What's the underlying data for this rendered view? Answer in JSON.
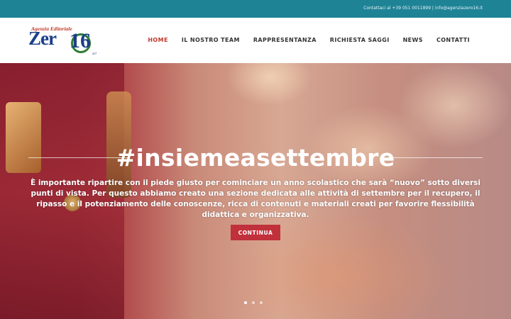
{
  "topbar": {
    "contact_text": "Contattaci al +39 051 0011899 | info@agenziazero16.it"
  },
  "logo": {
    "tagline": "Agenzia Editoriale",
    "word": "Zer",
    "number": "16",
    "suffix": "srl"
  },
  "nav": {
    "items": [
      {
        "label": "HOME"
      },
      {
        "label": "IL NOSTRO TEAM"
      },
      {
        "label": "RAPPRESENTANZA"
      },
      {
        "label": "RICHIESTA SAGGI"
      },
      {
        "label": "NEWS"
      },
      {
        "label": "CONTATTI"
      }
    ],
    "active_color": "#c0392b"
  },
  "hero": {
    "headline": "#insiemeasettembre",
    "body": "È importante ripartire con il piede giusto per cominciare un anno scolastico che sarà “nuovo” sotto diversi punti di vista. Per questo abbiamo creato una sezione dedicata alle attività di settembre per il recupero, il ripasso e il potenziamento delle conoscenze, ricca di contenuti e materiali creati per favorire flessibilità didattica e organizzativa.",
    "cta_label": "CONTINUA",
    "cta_color": "#c0313c"
  },
  "slider": {
    "slide_count": 3,
    "active_index": 0
  },
  "colors": {
    "topbar": "#1f8396",
    "brand_blue": "#1b3f8a"
  }
}
